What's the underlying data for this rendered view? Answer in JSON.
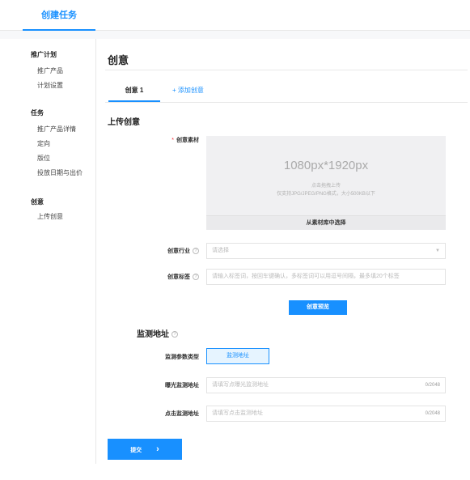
{
  "header": {
    "tab": "创建任务"
  },
  "sidebar": {
    "groups": [
      {
        "title": "推广计划",
        "items": [
          "推广产品",
          "计划设置"
        ]
      },
      {
        "title": "任务",
        "items": [
          "推广产品详情",
          "定向",
          "版位",
          "投放日期与出价"
        ]
      },
      {
        "title": "创意",
        "items": [
          "上传创意"
        ]
      }
    ]
  },
  "main": {
    "title": "创意",
    "tabs": {
      "active": "创意 1",
      "add": "+ 添加创意"
    },
    "upload_section": {
      "title": "上传创意",
      "material_label": "创意素材",
      "required_mark": "*",
      "size_text": "1080px*1920px",
      "hint1": "点击拖拽上传",
      "hint2": "仅支持JPG/JPEG/PNG格式，大小500KB以下",
      "library_button": "从素材库中选择"
    },
    "industry": {
      "label": "创意行业",
      "placeholder": "请选择"
    },
    "tags": {
      "label": "创意标签",
      "placeholder": "请输入标签词，按回车键确认，多标签词可以用逗号间隔，最多填20个标签"
    },
    "preview_button": "创意预览",
    "monitor_section": {
      "title": "监测地址",
      "param_type_label": "监测参数类型",
      "param_type_value": "监测地址",
      "impression": {
        "label": "曝光监测地址",
        "placeholder": "请填写点曝光监测地址",
        "counter": "0/2048"
      },
      "click": {
        "label": "点击监测地址",
        "placeholder": "请填写点击监测地址",
        "counter": "0/2048"
      }
    },
    "submit_button": "提交",
    "submit_arrow": "›"
  },
  "icons": {
    "help": "question-circle-icon",
    "dropdown": "chevron-down-icon",
    "submit": "chevron-right-icon"
  },
  "colors": {
    "accent": "#1890ff",
    "required": "#f5222d"
  }
}
